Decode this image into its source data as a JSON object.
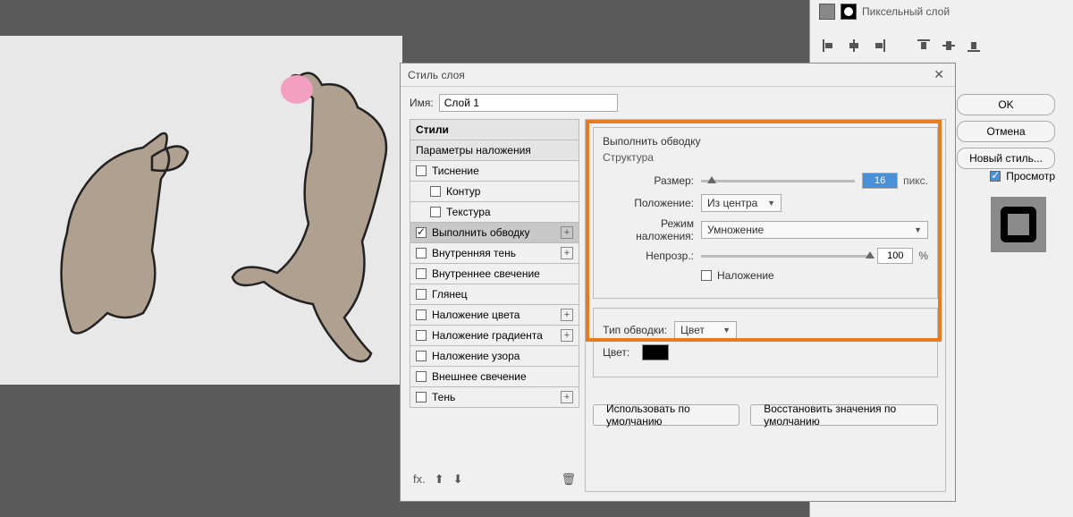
{
  "right_panel": {
    "layer_label": "Пиксельный слой"
  },
  "dialog": {
    "title": "Стиль слоя",
    "name_label": "Имя:",
    "name_value": "Слой 1",
    "styles_header": "Стили",
    "group_header": "Параметры наложения",
    "styles": [
      {
        "label": "Тиснение",
        "checked": false,
        "plus": false,
        "sub": false
      },
      {
        "label": "Контур",
        "checked": false,
        "plus": false,
        "sub": true
      },
      {
        "label": "Текстура",
        "checked": false,
        "plus": false,
        "sub": true
      },
      {
        "label": "Выполнить обводку",
        "checked": true,
        "plus": true,
        "sub": false,
        "selected": true
      },
      {
        "label": "Внутренняя тень",
        "checked": false,
        "plus": true,
        "sub": false
      },
      {
        "label": "Внутреннее свечение",
        "checked": false,
        "plus": false,
        "sub": false
      },
      {
        "label": "Глянец",
        "checked": false,
        "plus": false,
        "sub": false
      },
      {
        "label": "Наложение цвета",
        "checked": false,
        "plus": true,
        "sub": false
      },
      {
        "label": "Наложение градиента",
        "checked": false,
        "plus": true,
        "sub": false
      },
      {
        "label": "Наложение узора",
        "checked": false,
        "plus": false,
        "sub": false
      },
      {
        "label": "Внешнее свечение",
        "checked": false,
        "plus": false,
        "sub": false
      },
      {
        "label": "Тень",
        "checked": false,
        "plus": true,
        "sub": false
      }
    ],
    "footer_fx": "fx.",
    "footer_trash": "🗑"
  },
  "stroke": {
    "panel_title": "Выполнить обводку",
    "structure_label": "Структура",
    "size_label": "Размер:",
    "size_value": "16",
    "size_unit": "пикс.",
    "position_label": "Положение:",
    "position_value": "Из центра",
    "blend_label": "Режим наложения:",
    "blend_value": "Умножение",
    "opacity_label": "Непрозр.:",
    "opacity_value": "100",
    "opacity_unit": "%",
    "overprint_label": "Наложение",
    "type_label": "Тип обводки:",
    "type_value": "Цвет",
    "color_label": "Цвет:"
  },
  "bottom": {
    "use_default": "Использовать по умолчанию",
    "reset_default": "Восстановить значения по умолчанию"
  },
  "side": {
    "ok": "OK",
    "cancel": "Отмена",
    "new_style": "Новый стиль...",
    "preview": "Просмотр"
  }
}
